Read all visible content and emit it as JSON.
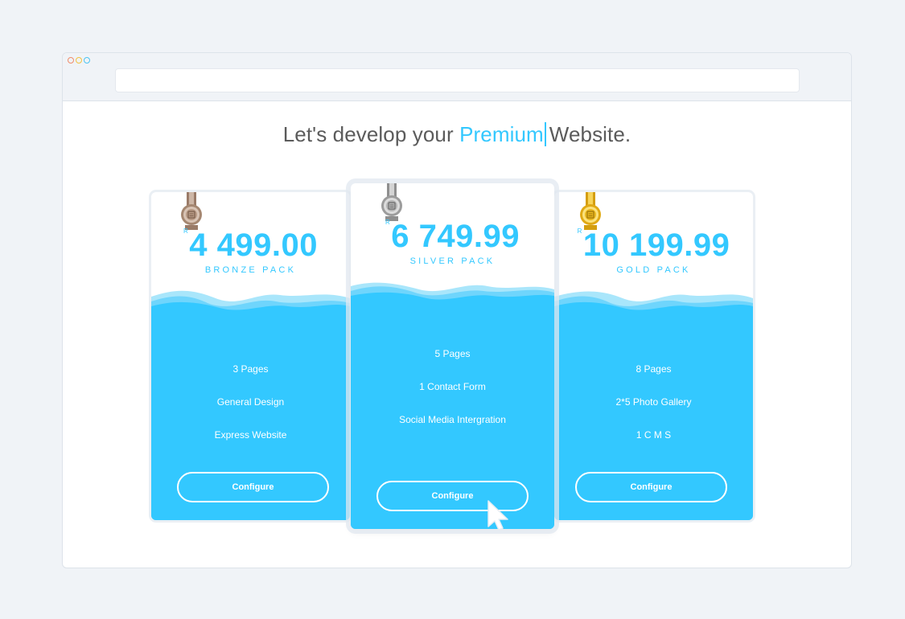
{
  "window": {
    "url": ""
  },
  "headline": {
    "prefix": "Let's develop your ",
    "highlight": "Premium",
    "suffix": "Website."
  },
  "plans": [
    {
      "currency": "R",
      "price": "4 499.00",
      "name": "BRONZE PACK",
      "medal": "bronze-medal-icon",
      "features": [
        "3 Pages",
        "General Design",
        "Express Website"
      ],
      "button": "Configure"
    },
    {
      "currency": "R",
      "price": "6 749.99",
      "name": "SILVER PACK",
      "medal": "silver-medal-icon",
      "features": [
        "5 Pages",
        "1 Contact Form",
        "Social Media Intergration"
      ],
      "button": "Configure"
    },
    {
      "currency": "R",
      "price": "10 199.99",
      "name": "GOLD PACK",
      "medal": "gold-medal-icon",
      "features": [
        "8 Pages",
        "2*5 Photo Gallery",
        "1 C M S"
      ],
      "button": "Configure"
    }
  ],
  "colors": {
    "accent": "#33c8ff",
    "bronze": "#b89a85",
    "silver": "#a7a7a7",
    "gold": "#e9b81f",
    "dot_red": "#f08c6a",
    "dot_yellow": "#f2c240",
    "dot_blue": "#4cc4f0"
  }
}
